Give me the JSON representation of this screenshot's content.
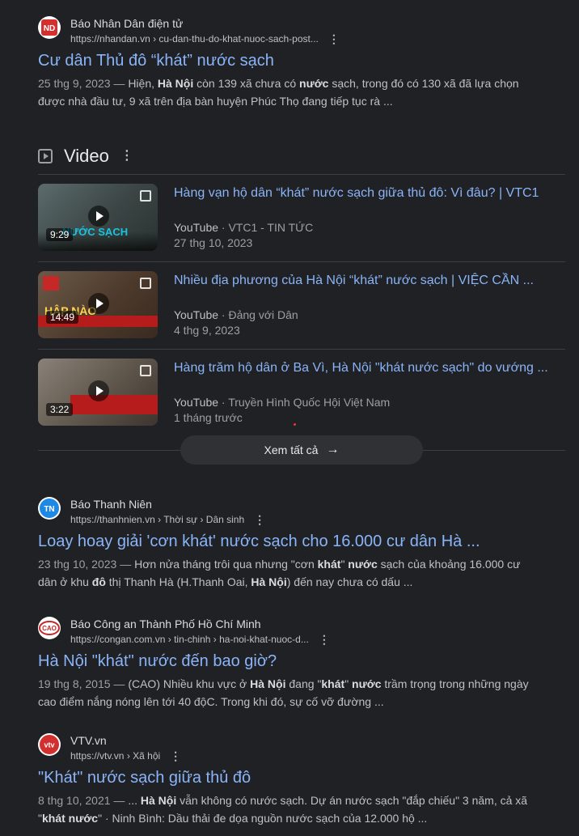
{
  "results": [
    {
      "site": "Báo Nhân Dân điện tử",
      "url": "https://nhandan.vn",
      "crumbs": "› cu-dan-thu-do-khat-nuoc-sach-post...",
      "title": "Cư dân Thủ đô “khát” nước sạch",
      "snippet_parts": [
        {
          "t": "25 thg 9, 2023 — ",
          "k": "date"
        },
        {
          "t": "Hiện, ",
          "k": ""
        },
        {
          "t": "Hà Nội",
          "k": "b"
        },
        {
          "t": " còn 139 xã chưa có ",
          "k": ""
        },
        {
          "t": "nước",
          "k": "b"
        },
        {
          "t": " sạch, trong đó có 130 xã đã lựa chọn được nhà đầu tư, 9 xã trên địa bàn huyện Phúc Thọ đang tiếp tục rà ...",
          "k": ""
        }
      ],
      "favicon_text": "ND",
      "favicon_color": "#d32f2f"
    },
    {
      "site": "Báo Thanh Niên",
      "url": "https://thanhnien.vn",
      "crumbs": "› Thời sự › Dân sinh",
      "title": "Loay hoay giải 'cơn khát' nước sạch cho 16.000 cư dân Hà ...",
      "snippet_parts": [
        {
          "t": "23 thg 10, 2023 — ",
          "k": "date"
        },
        {
          "t": "Hơn nửa tháng trôi qua nhưng \"cơn ",
          "k": ""
        },
        {
          "t": "khát",
          "k": "b"
        },
        {
          "t": "\" ",
          "k": ""
        },
        {
          "t": "nước",
          "k": "b"
        },
        {
          "t": " sạch của khoảng 16.000 cư dân ở khu ",
          "k": ""
        },
        {
          "t": "đô",
          "k": "b"
        },
        {
          "t": " thị Thanh Hà (H.Thanh Oai, ",
          "k": ""
        },
        {
          "t": "Hà Nội",
          "k": "b"
        },
        {
          "t": ") đến nay chưa có dấu ...",
          "k": ""
        }
      ],
      "favicon_text": "TN",
      "favicon_color": "#1e88e5"
    },
    {
      "site": "Báo Công an Thành Phố Hồ Chí Minh",
      "url": "https://congan.com.vn",
      "crumbs": "› tin-chinh › ha-noi-khat-nuoc-d...",
      "title": "Hà Nội \"khát\" nước đến bao giờ?",
      "snippet_parts": [
        {
          "t": "19 thg 8, 2015 — ",
          "k": "date"
        },
        {
          "t": "(CAO) Nhiều khu vực ở ",
          "k": ""
        },
        {
          "t": "Hà Nội",
          "k": "b"
        },
        {
          "t": " đang \"",
          "k": ""
        },
        {
          "t": "khát",
          "k": "b"
        },
        {
          "t": "\" ",
          "k": ""
        },
        {
          "t": "nước",
          "k": "b"
        },
        {
          "t": " trầm trọng trong những ngày cao điểm nắng nóng lên tới 40 độC. Trong khi đó, sự cố vỡ đường ...",
          "k": ""
        }
      ],
      "favicon_text": "CAO",
      "favicon_color": "#c62828"
    },
    {
      "site": "VTV.vn",
      "url": "https://vtv.vn",
      "crumbs": "› Xã hội",
      "title": "\"Khát\" nước sạch giữa thủ đô",
      "snippet_parts": [
        {
          "t": "8 thg 10, 2021 — ",
          "k": "date"
        },
        {
          "t": "... ",
          "k": ""
        },
        {
          "t": "Hà Nội",
          "k": "b"
        },
        {
          "t": " vẫn không có nước sạch. Dự án nước sạch \"đắp chiếu\" 3 năm, cả xã \"",
          "k": ""
        },
        {
          "t": "khát nước",
          "k": "b"
        },
        {
          "t": "\" · Ninh Bình: Dầu thải đe dọa nguồn nước sạch của 12.000 hộ ...",
          "k": ""
        }
      ],
      "favicon_text": "vtv",
      "favicon_color": "#d32f2f"
    }
  ],
  "video_section": {
    "heading": "Video",
    "items": [
      {
        "title": "Hàng vạn hộ dân “khát” nước sạch giữa thủ đô: Vì đâu? | VTC1",
        "platform": "YouTube",
        "channel": "· VTC1 - TIN TỨC",
        "date": "27 thg 10, 2023",
        "duration": "9:29",
        "thumb_colors": [
          "#4a5a5c",
          "#2f3b3a",
          "#18a9c4"
        ]
      },
      {
        "title": "Nhiều địa phương của Hà Nội “khát” nước sạch | VIỆC CẦN ...",
        "platform": "YouTube",
        "channel": "· Đảng với Dân",
        "date": "4 thg 9, 2023",
        "duration": "14:49",
        "thumb_colors": [
          "#5a4535",
          "#7a2a22",
          "#c62828"
        ]
      },
      {
        "title": "Hàng trăm hộ dân ở Ba Vì, Hà Nội \"khát nước sạch\" do vướng ...",
        "platform": "YouTube",
        "channel": "· Truyền Hình Quốc Hội Việt Nam",
        "date": "1 tháng trước",
        "duration": "3:22",
        "thumb_colors": [
          "#6b6258",
          "#4a3f37",
          "#b71c1c"
        ]
      }
    ],
    "see_all": "Xem tất cả",
    "arrow": "→"
  },
  "icons": {
    "kebab": "⋮",
    "play": "play-icon"
  }
}
